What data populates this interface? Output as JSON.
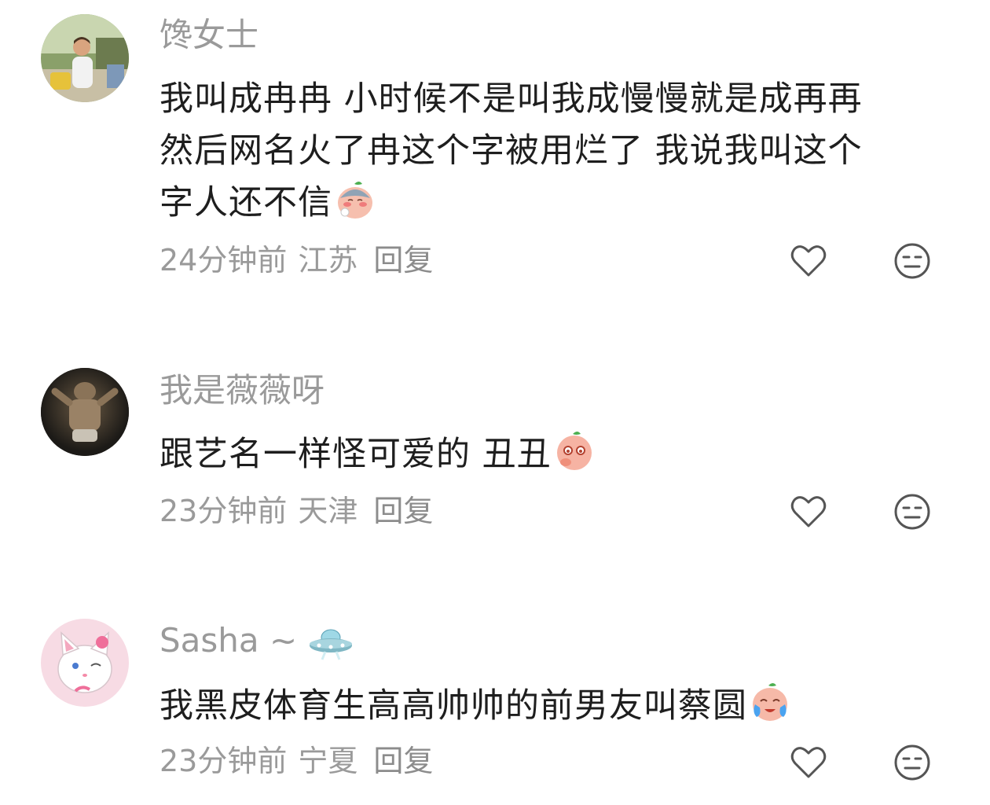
{
  "comments": [
    {
      "username": "馋女士",
      "text_lines": [
        "我叫成冉冉 小时候不是叫我成慢慢就是成再再",
        "然后网名火了冉这个字被用烂了 我说我叫这个",
        "字人还不信"
      ],
      "emoji": "blushing-bun-emoji",
      "time": "24分钟前",
      "location": "江苏",
      "reply_label": "回复",
      "avatar": "woman-outdoors-avatar"
    },
    {
      "username": "我是薇薇呀",
      "text_lines": [
        "跟艺名一样怪可爱的 丑丑"
      ],
      "emoji": "shy-bun-emoji",
      "time": "23分钟前",
      "location": "天津",
      "reply_label": "回复",
      "avatar": "dark-figure-avatar"
    },
    {
      "username": "Sasha ~",
      "username_badge": "ufo-icon",
      "text_lines": [
        "我黑皮体育生高高帅帅的前男友叫蔡圆"
      ],
      "emoji": "crying-bun-emoji",
      "time": "23分钟前",
      "location": "宁夏",
      "reply_label": "回复",
      "avatar": "white-cat-avatar"
    }
  ],
  "icons": {
    "like": "heart-outline-icon",
    "dislike": "meh-face-icon"
  },
  "colors": {
    "text": "#1e1e1e",
    "muted": "#9a9a9a",
    "background": "#ffffff"
  }
}
